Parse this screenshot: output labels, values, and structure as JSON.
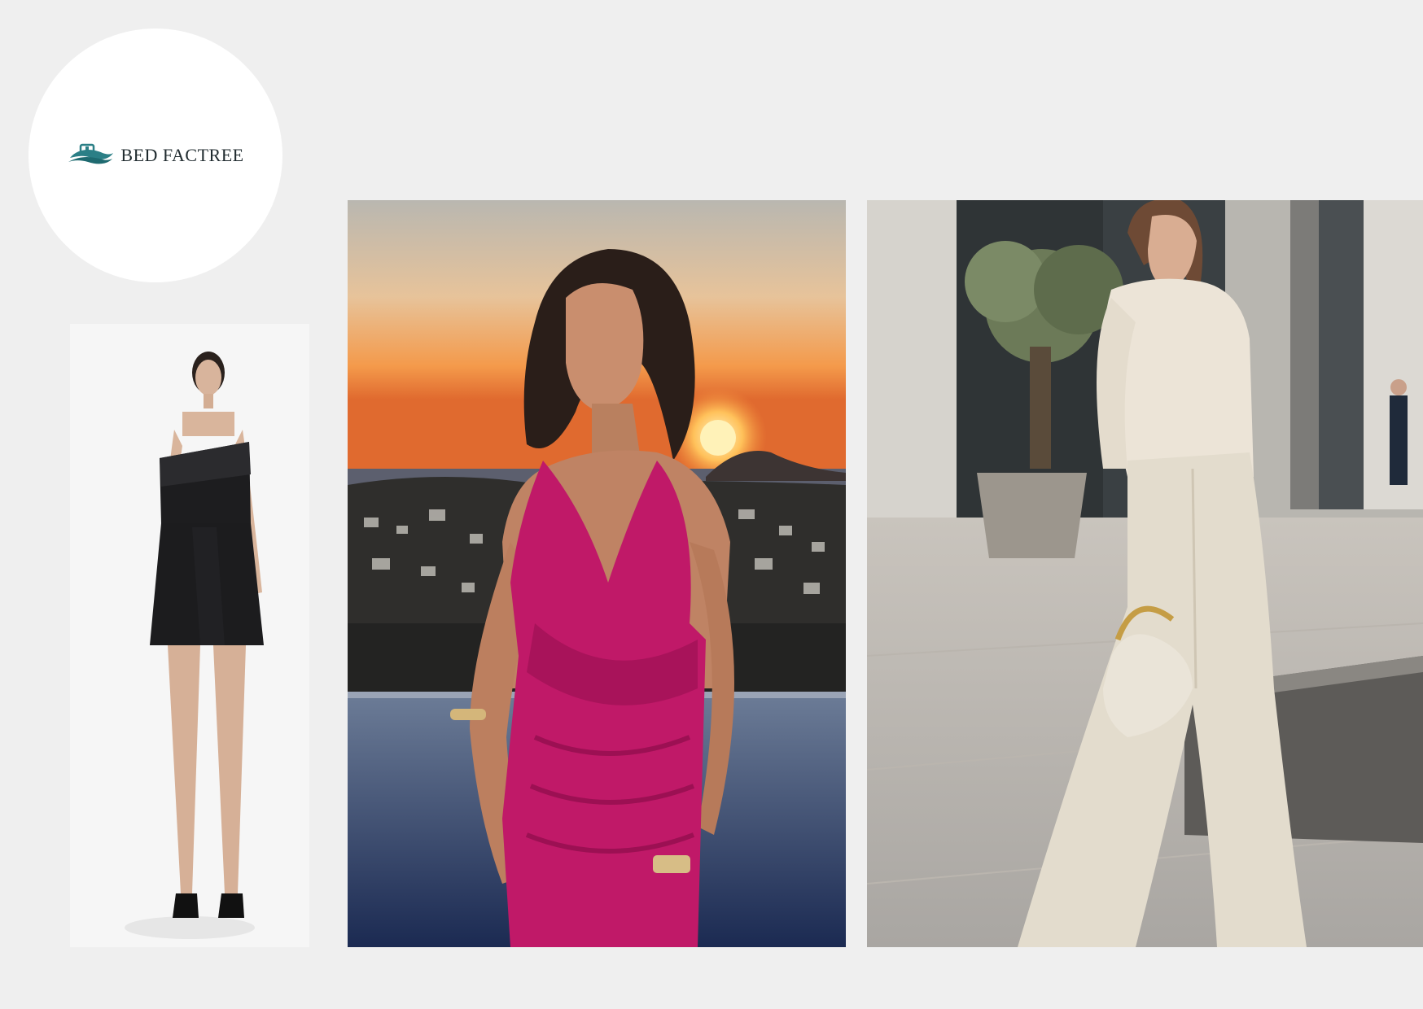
{
  "brand": {
    "name": "BED FACTREE",
    "accent_color": "#2b7f86",
    "icon": "wave-logo-icon"
  },
  "photos": [
    {
      "subject": "black-strapless-mini-dress"
    },
    {
      "subject": "magenta-halter-dress-at-sunset"
    },
    {
      "subject": "cream-shirt-and-wide-leg-jeans-with-handbag"
    }
  ]
}
